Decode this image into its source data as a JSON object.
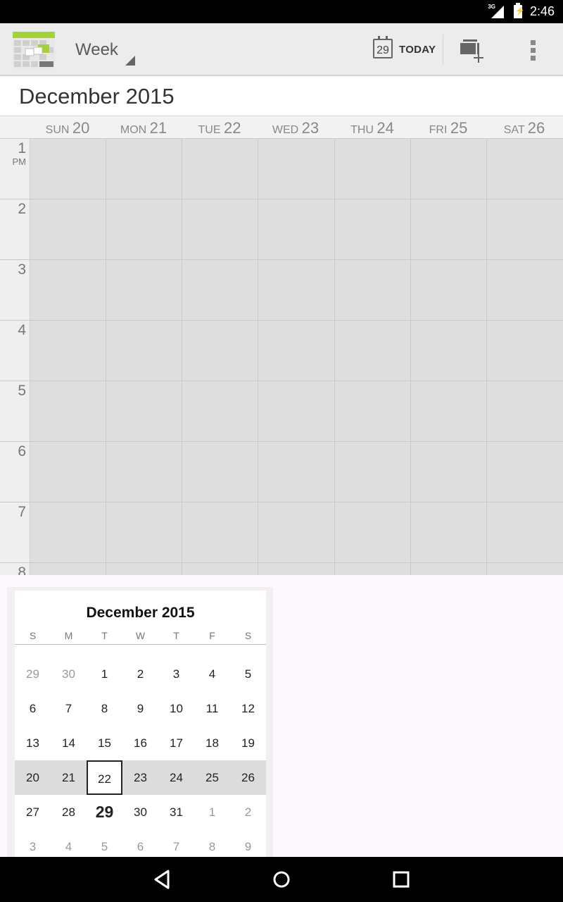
{
  "status_bar": {
    "time": "2:46",
    "network": "3G"
  },
  "action_bar": {
    "view_label": "Week",
    "today_date": "29",
    "today_label": "TODAY"
  },
  "month_title": "December 2015",
  "week_days": [
    {
      "dow": "SUN",
      "date": "20"
    },
    {
      "dow": "MON",
      "date": "21"
    },
    {
      "dow": "TUE",
      "date": "22"
    },
    {
      "dow": "WED",
      "date": "23"
    },
    {
      "dow": "THU",
      "date": "24"
    },
    {
      "dow": "FRI",
      "date": "25"
    },
    {
      "dow": "SAT",
      "date": "26"
    }
  ],
  "hours": [
    "1",
    "2",
    "3",
    "4",
    "5",
    "6",
    "7",
    "8"
  ],
  "first_hour_suffix": "PM",
  "mini_calendar": {
    "title": "December 2015",
    "dow": [
      "S",
      "M",
      "T",
      "W",
      "T",
      "F",
      "S"
    ],
    "weeks": [
      [
        "29",
        "30",
        "1",
        "2",
        "3",
        "4",
        "5"
      ],
      [
        "6",
        "7",
        "8",
        "9",
        "10",
        "11",
        "12"
      ],
      [
        "13",
        "14",
        "15",
        "16",
        "17",
        "18",
        "19"
      ],
      [
        "20",
        "21",
        "22",
        "23",
        "24",
        "25",
        "26"
      ],
      [
        "27",
        "28",
        "29",
        "30",
        "31",
        "1",
        "2"
      ],
      [
        "3",
        "4",
        "5",
        "6",
        "7",
        "8",
        "9"
      ]
    ],
    "other_month_cells": [
      [
        0,
        0
      ],
      [
        0,
        1
      ],
      [
        4,
        5
      ],
      [
        4,
        6
      ],
      [
        5,
        0
      ],
      [
        5,
        1
      ],
      [
        5,
        2
      ],
      [
        5,
        3
      ],
      [
        5,
        4
      ],
      [
        5,
        5
      ],
      [
        5,
        6
      ]
    ],
    "highlighted_week": 3,
    "selected_cell": [
      3,
      2
    ],
    "today_cell": [
      4,
      2
    ]
  },
  "colors": {
    "action_bar_bg": "#ececec",
    "grid_bg": "#dedede",
    "week_highlight": "#dcdcdc",
    "app_icon_accent": "#a4d233"
  },
  "icons": {
    "app": "calendar-app-icon",
    "spinner": "dropdown-triangle-icon",
    "today": "calendar-today-icon",
    "new_event": "new-event-icon",
    "overflow": "overflow-menu-icon",
    "nav_back": "back-icon",
    "nav_home": "home-icon",
    "nav_recents": "recents-icon"
  }
}
